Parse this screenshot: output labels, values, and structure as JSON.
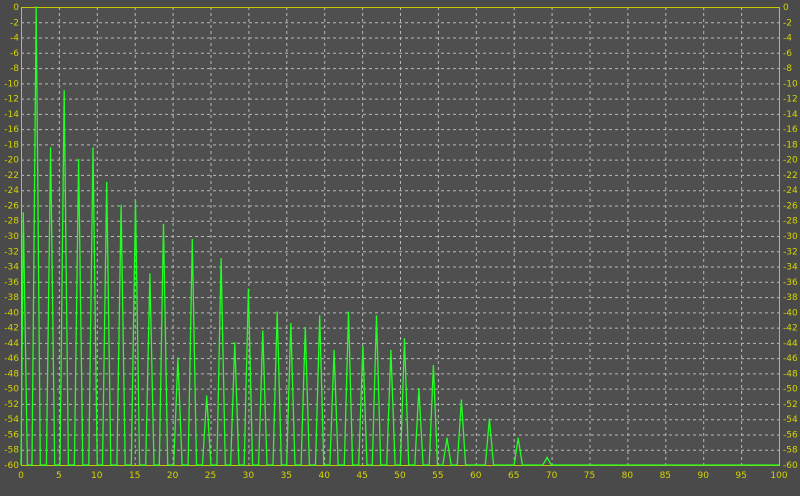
{
  "theme": {
    "background": "#4a4a4a",
    "plot_background": "#4f4f4f",
    "grid_color": "#b9b9b9",
    "frame_color": "#c8c800",
    "tick_label_color": "#d4d400",
    "line_color": "#22ff22"
  },
  "chart_data": {
    "type": "line",
    "title": "",
    "xlabel": "",
    "ylabel": "",
    "xlim": [
      0,
      100
    ],
    "ylim": [
      -60,
      0
    ],
    "x_ticks": [
      0,
      5,
      10,
      15,
      20,
      25,
      30,
      35,
      40,
      45,
      50,
      55,
      60,
      65,
      70,
      75,
      80,
      85,
      90,
      95,
      100
    ],
    "y_ticks": [
      0,
      -2,
      -4,
      -6,
      -8,
      -10,
      -12,
      -14,
      -16,
      -18,
      -20,
      -22,
      -24,
      -26,
      -28,
      -30,
      -32,
      -34,
      -36,
      -38,
      -40,
      -42,
      -44,
      -46,
      -48,
      -50,
      -52,
      -54,
      -56,
      -58,
      -60
    ],
    "y_axis_right": true,
    "grid": true,
    "series": [
      {
        "peaks": [
          {
            "x": 0.3,
            "y": -27
          },
          {
            "x": 2.0,
            "y": 0
          },
          {
            "x": 3.9,
            "y": -18.5
          },
          {
            "x": 5.7,
            "y": -11
          },
          {
            "x": 7.6,
            "y": -20
          },
          {
            "x": 9.5,
            "y": -18.5
          },
          {
            "x": 11.3,
            "y": -23
          },
          {
            "x": 13.2,
            "y": -26
          },
          {
            "x": 15.1,
            "y": -25.5
          },
          {
            "x": 17.0,
            "y": -35
          },
          {
            "x": 18.8,
            "y": -28.5
          },
          {
            "x": 20.7,
            "y": -46
          },
          {
            "x": 22.6,
            "y": -30.5
          },
          {
            "x": 24.5,
            "y": -51
          },
          {
            "x": 26.4,
            "y": -33
          },
          {
            "x": 28.2,
            "y": -44
          },
          {
            "x": 30.0,
            "y": -37
          },
          {
            "x": 31.9,
            "y": -42.5
          },
          {
            "x": 33.8,
            "y": -40
          },
          {
            "x": 35.6,
            "y": -41.5
          },
          {
            "x": 37.5,
            "y": -42
          },
          {
            "x": 39.4,
            "y": -40.5
          },
          {
            "x": 41.3,
            "y": -45
          },
          {
            "x": 43.2,
            "y": -40
          },
          {
            "x": 45.1,
            "y": -44.5
          },
          {
            "x": 46.9,
            "y": -40.5
          },
          {
            "x": 48.8,
            "y": -45
          },
          {
            "x": 50.6,
            "y": -43.5
          },
          {
            "x": 52.5,
            "y": -50
          },
          {
            "x": 54.4,
            "y": -47
          },
          {
            "x": 56.2,
            "y": -56.5
          },
          {
            "x": 58.1,
            "y": -51.5
          },
          {
            "x": 61.8,
            "y": -54
          },
          {
            "x": 65.6,
            "y": -56.5
          },
          {
            "x": 69.4,
            "y": -59
          }
        ]
      }
    ]
  }
}
